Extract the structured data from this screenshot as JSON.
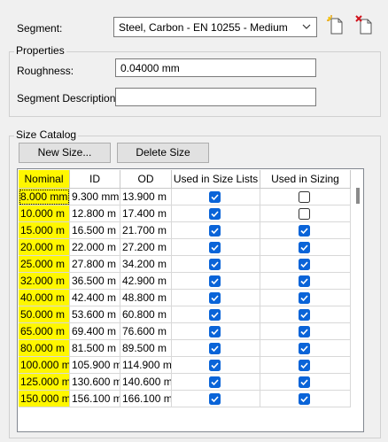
{
  "segment": {
    "label": "Segment:",
    "value": "Steel, Carbon - EN 10255 - Medium"
  },
  "toolbar": {
    "new_icon": "new-segment-icon",
    "delete_icon": "delete-segment-icon"
  },
  "properties": {
    "title": "Properties",
    "roughness_label": "Roughness:",
    "roughness_value": "0.04000 mm",
    "description_label": "Segment Description:",
    "description_value": ""
  },
  "size_catalog": {
    "title": "Size Catalog",
    "new_size_label": "New Size...",
    "delete_size_label": "Delete Size",
    "columns": [
      "Nominal",
      "ID",
      "OD",
      "Used in Size Lists",
      "Used in Sizing"
    ],
    "rows": [
      {
        "nominal": "8.000 mm",
        "id": "9.300 mm",
        "od": "13.900 m",
        "size_lists": true,
        "sizing": false
      },
      {
        "nominal": "10.000 m",
        "id": "12.800 m",
        "od": "17.400 m",
        "size_lists": true,
        "sizing": false
      },
      {
        "nominal": "15.000 m",
        "id": "16.500 m",
        "od": "21.700 m",
        "size_lists": true,
        "sizing": true
      },
      {
        "nominal": "20.000 m",
        "id": "22.000 m",
        "od": "27.200 m",
        "size_lists": true,
        "sizing": true
      },
      {
        "nominal": "25.000 m",
        "id": "27.800 m",
        "od": "34.200 m",
        "size_lists": true,
        "sizing": true
      },
      {
        "nominal": "32.000 m",
        "id": "36.500 m",
        "od": "42.900 m",
        "size_lists": true,
        "sizing": true
      },
      {
        "nominal": "40.000 m",
        "id": "42.400 m",
        "od": "48.800 m",
        "size_lists": true,
        "sizing": true
      },
      {
        "nominal": "50.000 m",
        "id": "53.600 m",
        "od": "60.800 m",
        "size_lists": true,
        "sizing": true
      },
      {
        "nominal": "65.000 m",
        "id": "69.400 m",
        "od": "76.600 m",
        "size_lists": true,
        "sizing": true
      },
      {
        "nominal": "80.000 m",
        "id": "81.500 m",
        "od": "89.500 m",
        "size_lists": true,
        "sizing": true
      },
      {
        "nominal": "100.000 m",
        "id": "105.900 m",
        "od": "114.900 m",
        "size_lists": true,
        "sizing": true
      },
      {
        "nominal": "125.000 m",
        "id": "130.600 m",
        "od": "140.600 m",
        "size_lists": true,
        "sizing": true
      },
      {
        "nominal": "150.000 m",
        "id": "156.100 m",
        "od": "166.100 m",
        "size_lists": true,
        "sizing": true
      }
    ]
  },
  "colors": {
    "highlight": "#fff700",
    "checkbox_checked": "#0a64d8",
    "window_bg": "#f0f0f0"
  }
}
